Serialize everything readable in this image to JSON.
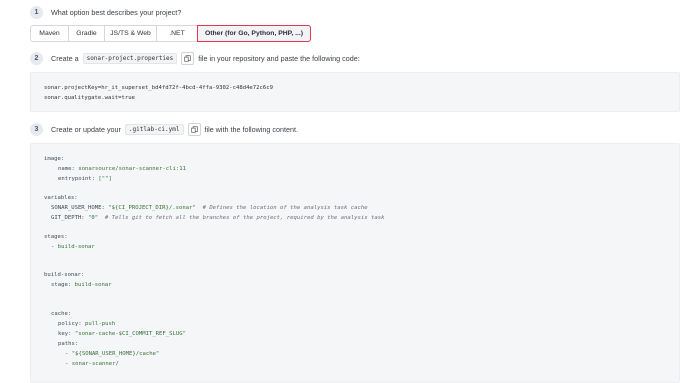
{
  "step1": {
    "number": "1",
    "question": "What option best describes your project?",
    "tabs": [
      "Maven",
      "Gradle",
      "JS/TS & Web",
      ".NET",
      "Other (for Go, Python, PHP, ...)"
    ],
    "selected_tab": "Other (for Go, Python, PHP, ...)"
  },
  "step2": {
    "number": "2",
    "text_before": "Create a",
    "filename": "sonar-project.properties",
    "text_after": "file in your repository and paste the following code:",
    "code": [
      "sonar.projectKey=hr_it_superset_bd4fd72f-4bcd-4ffa-9302-c48d4e72c6c9",
      "sonar.qualitygate.wait=true"
    ]
  },
  "step3": {
    "number": "3",
    "text_before": "Create or update your",
    "filename": ".gitlab-ci.yml",
    "text_after": "file with the following content.",
    "code": {
      "image_key": "image:",
      "name_key": "name:",
      "name_val": "sonarsource/sonar-scanner-cli:11",
      "entrypoint_key": "entrypoint:",
      "entrypoint_val": "[\"\"]",
      "variables_key": "variables:",
      "sonar_home_key": "SONAR_USER_HOME:",
      "sonar_home_val": "\"${CI_PROJECT_DIR}/.sonar\"",
      "sonar_home_comment": "# Defines the location of the analysis task cache",
      "git_depth_key": "GIT_DEPTH:",
      "git_depth_val": "\"0\"",
      "git_depth_comment": "# Tells git to fetch all the branches of the project, required by the analysis task",
      "stages_key": "stages:",
      "stages_item": "- build-sonar",
      "job_key": "build-sonar:",
      "stage_key": "stage:",
      "stage_val": "build-sonar",
      "cache_key": "cache:",
      "policy_key": "policy:",
      "policy_val": "pull-push",
      "key_key": "key:",
      "key_val": "\"sonar-cache-$CI_COMMIT_REF_SLUG\"",
      "paths_key": "paths:",
      "path1": "- \"${SONAR_USER_HOME}/cache\"",
      "path2": "- sonar-scanner/"
    }
  }
}
